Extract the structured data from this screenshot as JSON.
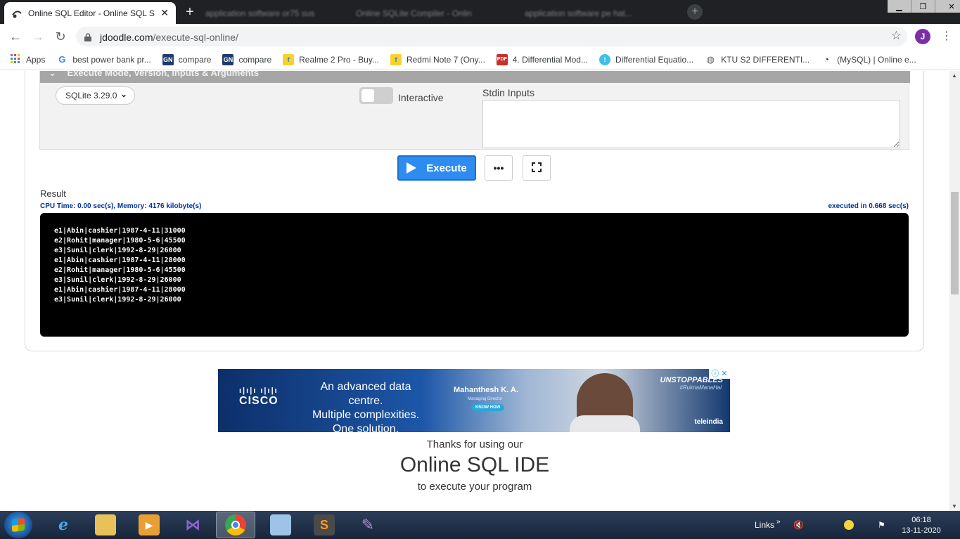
{
  "browser": {
    "active_tab": {
      "title": "Online SQL Editor - Online SQL S"
    },
    "background_tabs": [
      "application software or75 sus",
      "Online SQLite Compiler - Onlin",
      "application software pe hat..."
    ],
    "url_host": "jdoodle.com",
    "url_path": "/execute-sql-online/",
    "profile_initial": "J"
  },
  "bookmarks": [
    {
      "label": "Apps",
      "icon": "apps-grid-icon"
    },
    {
      "label": "best power bank pr...",
      "icon": "google-icon"
    },
    {
      "label": "compare",
      "icon": "gn-icon"
    },
    {
      "label": "compare",
      "icon": "gn-icon"
    },
    {
      "label": "Realme 2 Pro - Buy...",
      "icon": "flipkart-icon"
    },
    {
      "label": "Redmi Note 7 (Ony...",
      "icon": "flipkart-icon"
    },
    {
      "label": "4. Differential Mod...",
      "icon": "pdf-icon"
    },
    {
      "label": "Differential Equatio...",
      "icon": "site-icon"
    },
    {
      "label": "KTU S2 DIFFERENTI...",
      "icon": "globe-icon"
    },
    {
      "label": "(MySQL) | Online e...",
      "icon": "jdoodle-icon"
    }
  ],
  "execute_panel": {
    "header": "Execute Mode, Version, Inputs & Arguments",
    "version": "SQLite 3.29.0",
    "interactive_label": "Interactive",
    "stdin_label": "Stdin Inputs",
    "stdin_value": ""
  },
  "actions": {
    "execute_label": "Execute",
    "more_label": "•••"
  },
  "result": {
    "label": "Result",
    "stats": "CPU Time: 0.00 sec(s), Memory: 4176 kilobyte(s)",
    "executed": "executed in 0.668 sec(s)",
    "lines": [
      "e1|Abin|cashier|1987-4-11|31000",
      "e2|Rohit|manager|1980-5-6|45500",
      "e3|Sunil|clerk|1992-8-29|26000",
      "e1|Abin|cashier|1987-4-11|28000",
      "e2|Rohit|manager|1980-5-6|45500",
      "e3|Sunil|clerk|1992-8-29|26000",
      "e1|Abin|cashier|1987-4-11|28000",
      "e3|Sunil|clerk|1992-8-29|26000"
    ]
  },
  "ad": {
    "brand": "CISCO",
    "copy_line1": "An advanced data centre.",
    "copy_line2": "Multiple complexities.",
    "copy_line3": "One solution.",
    "person_name": "Mahanthesh K. A.",
    "person_role": "Managing Director",
    "cta": "KNOW HOW",
    "campaign": "UNSTOPPABLES",
    "hashtag": "#RuknaManaHai",
    "partner": "teleindia"
  },
  "footer": {
    "line1": "Thanks for using our",
    "line2": "Online SQL IDE",
    "line3": "to execute your program"
  },
  "taskbar": {
    "links_label": "Links",
    "time": "06:18",
    "date": "13-11-2020"
  },
  "colors": {
    "execute_blue": "#2e8cf0",
    "stats_blue": "#003399",
    "output_bg": "#000000"
  }
}
